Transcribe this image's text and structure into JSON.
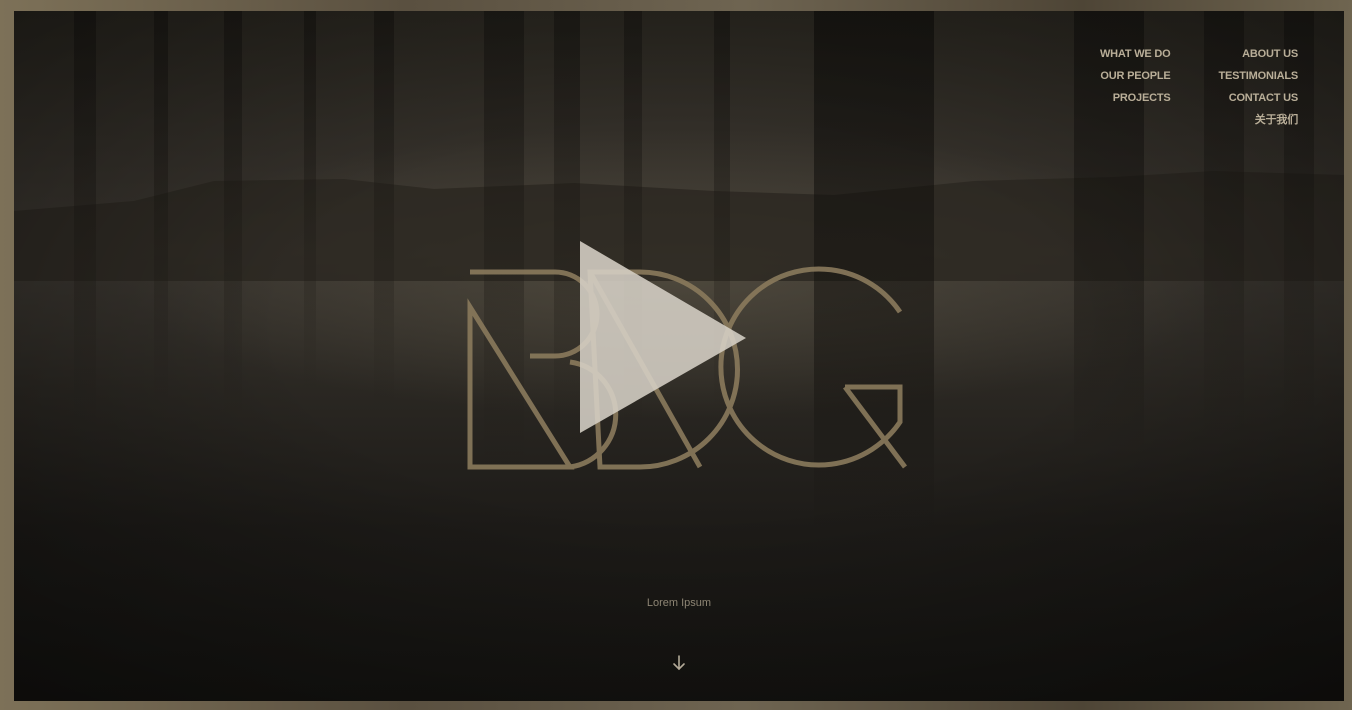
{
  "nav": {
    "left_column": [
      {
        "label": "WHAT WE DO"
      },
      {
        "label": "OUR PEOPLE"
      },
      {
        "label": "PROJECTS"
      }
    ],
    "right_column": [
      {
        "label": "ABOUT US"
      },
      {
        "label": "TESTIMONIALS"
      },
      {
        "label": "CONTACT US"
      },
      {
        "label": "关于我们"
      }
    ]
  },
  "hero": {
    "logo_text": "BDG",
    "tagline": "Lorem Ipsum",
    "play_icon": "play-icon",
    "scroll_icon": "arrow-down-icon"
  },
  "colors": {
    "nav_text": "#b9ae98",
    "logo_stroke": "#8a7a5c",
    "play_fill": "#d6d0c6",
    "frame": "#6b5f49"
  }
}
